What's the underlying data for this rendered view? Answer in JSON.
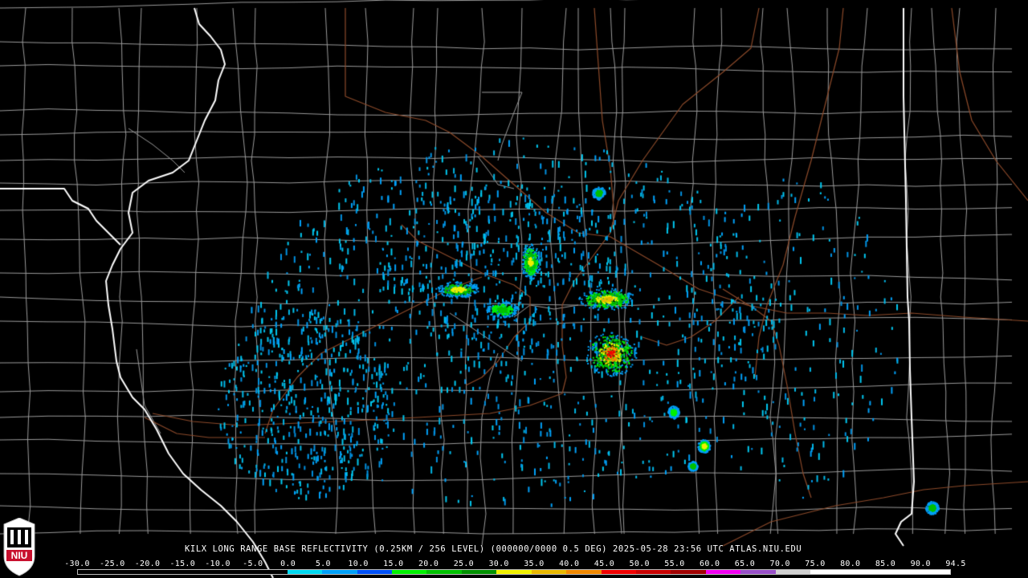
{
  "product_caption": "KILX LONG RANGE BASE REFLECTIVITY (0.25KM / 256 LEVEL) (000000/0000 0.5 DEG) 2025-05-28 23:56 UTC  ATLAS.NIU.EDU",
  "logo": {
    "text": "NIU",
    "color": "#c8102e"
  },
  "colorbar": {
    "labels": [
      "-30.0",
      "-25.0",
      "-20.0",
      "-15.0",
      "-10.0",
      "-5.0",
      "0.0",
      "5.0",
      "10.0",
      "15.0",
      "20.0",
      "25.0",
      "30.0",
      "35.0",
      "40.0",
      "45.0",
      "50.0",
      "55.0",
      "60.0",
      "65.0",
      "70.0",
      "75.0",
      "80.0",
      "85.0",
      "90.0",
      "94.5"
    ],
    "colors": [
      "#000000",
      "#000000",
      "#000000",
      "#000000",
      "#000000",
      "#000000",
      "#00d8f0",
      "#00a0f8",
      "#0050f8",
      "#00f000",
      "#00c000",
      "#009000",
      "#f0f000",
      "#e8b800",
      "#f08800",
      "#f00000",
      "#c80000",
      "#a00000",
      "#f000f0",
      "#9850c8",
      "#d0d0d0",
      "#ffffff",
      "#ffffff",
      "#ffffff",
      "#ffffff"
    ]
  },
  "map_colors": {
    "state_border": "#ffffff",
    "county_border": "#9a9a9a",
    "interstate": "#8c4a2a"
  },
  "radar_cores": [
    {
      "name": "se-cell",
      "dbz": 50
    },
    {
      "name": "east-cell",
      "dbz": 45
    },
    {
      "name": "north-cell",
      "dbz": 40
    },
    {
      "name": "west-cell",
      "dbz": 35
    },
    {
      "name": "sse-cell",
      "dbz": 40
    },
    {
      "name": "south-cell",
      "dbz": 30
    }
  ]
}
